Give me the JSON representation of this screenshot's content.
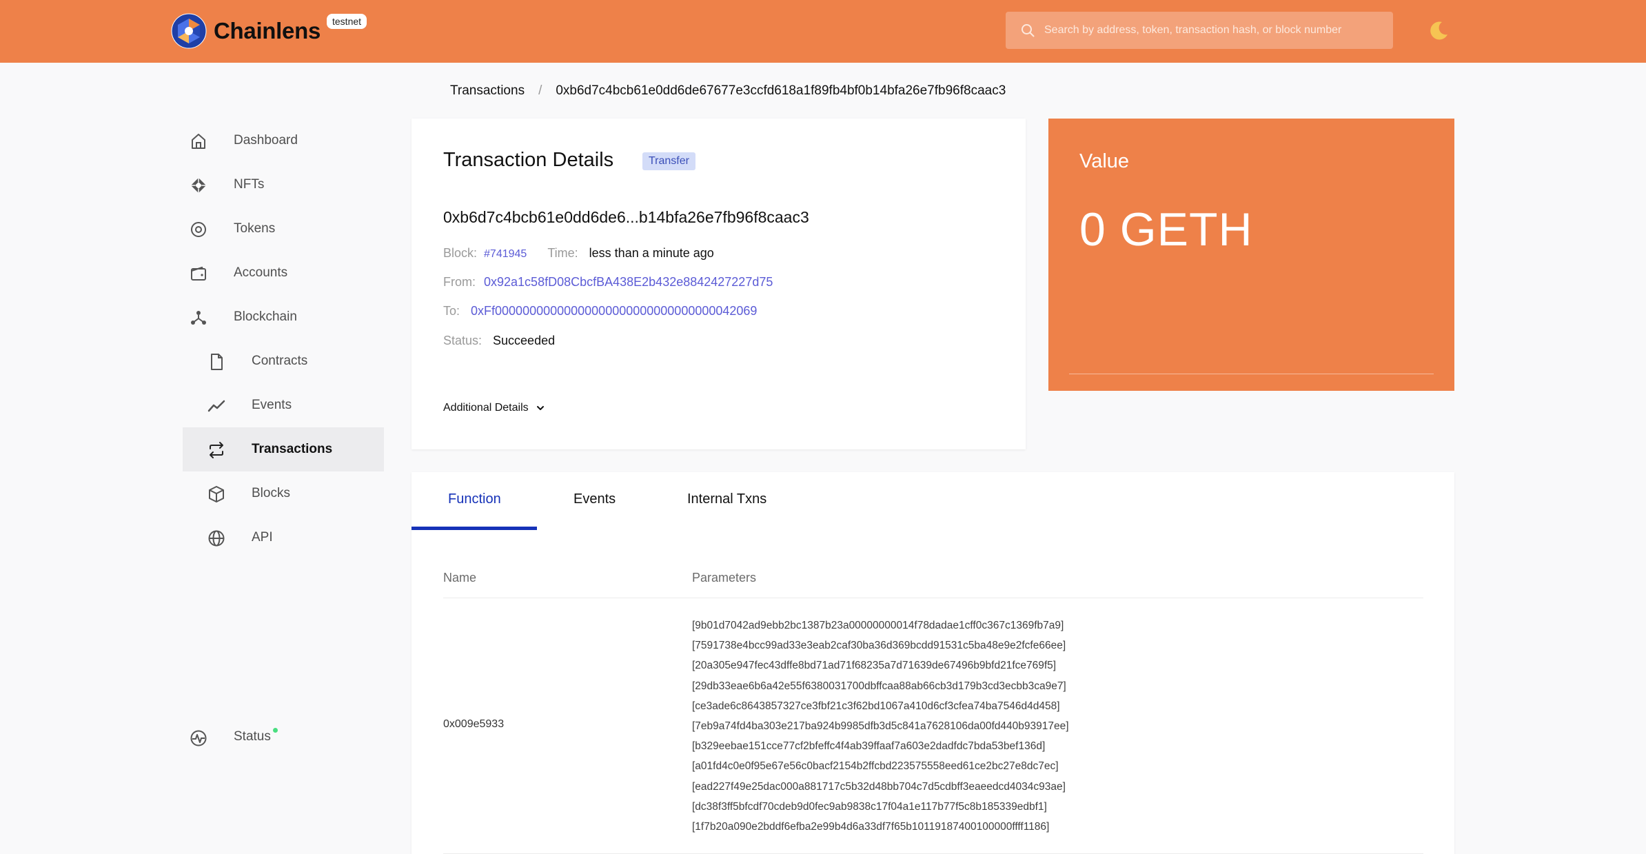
{
  "header": {
    "brand": "Chainlens",
    "env_badge": "testnet",
    "search_placeholder": "Search by address, token, transaction hash, or block number",
    "accent": "#ee8149"
  },
  "sidebar": {
    "items": [
      {
        "label": "Dashboard",
        "icon": "home-icon"
      },
      {
        "label": "NFTs",
        "icon": "diamond-icon"
      },
      {
        "label": "Tokens",
        "icon": "coin-icon"
      },
      {
        "label": "Accounts",
        "icon": "wallet-icon"
      },
      {
        "label": "Blockchain",
        "icon": "network-icon"
      },
      {
        "label": "Contracts",
        "icon": "document-icon"
      },
      {
        "label": "Events",
        "icon": "trend-icon"
      },
      {
        "label": "Transactions",
        "icon": "arrows-swap-icon",
        "active": true
      },
      {
        "label": "Blocks",
        "icon": "cube-icon"
      },
      {
        "label": "API",
        "icon": "globe-icon"
      }
    ],
    "status_label": "Status"
  },
  "breadcrumb": {
    "parent": "Transactions",
    "separator": "/",
    "current": "0xb6d7c4bcb61e0dd6de67677e3ccfd618a1f89fb4bf0b14bfa26e7fb96f8caac3"
  },
  "details": {
    "title": "Transaction Details",
    "type_badge": "Transfer",
    "hash_short": "0xb6d7c4bcb61e0dd6de6...b14bfa26e7fb96f8caac3",
    "block_label": "Block:",
    "block_value": "#741945",
    "time_label": "Time:",
    "time_value": "less than a minute ago",
    "from_label": "From:",
    "from_value": "0x92a1c58fD08CbcfBA438E2b432e8842427227d75",
    "to_label": "To:",
    "to_value": "0xFf00000000000000000000000000000000042069",
    "status_label": "Status:",
    "status_value": "Succeeded",
    "additional_label": "Additional Details"
  },
  "value_card": {
    "label": "Value",
    "amount": "0 GETH"
  },
  "tabs": {
    "items": [
      "Function",
      "Events",
      "Internal Txns"
    ],
    "active": "Function",
    "columns": [
      "Name",
      "Parameters"
    ],
    "function_name": "0x009e5933",
    "parameters": [
      "[9b01d7042ad9ebb2bc1387b23a00000000014f78dadae1cff0c367c1369fb7a9]",
      "[7591738e4bcc99ad33e3eab2caf30ba36d369bcdd91531c5ba48e9e2fcfe66ee]",
      "[20a305e947fec43dffe8bd71ad71f68235a7d71639de67496b9bfd21fce769f5]",
      "[29db33eae6b6a42e55f6380031700dbffcaa88ab66cb3d179b3cd3ecbb3ca9e7]",
      "[ce3ade6c8643857327ce3fbf21c3f62bd1067a410d6cf3cfea74ba7546d4d458]",
      "[7eb9a74fd4ba303e217ba924b9985dfb3d5c841a7628106da00fd440b93917ee]",
      "[b329eebae151cce77cf2bfeffc4f4ab39ffaaf7a603e2dadfdc7bda53bef136d]",
      "[a01fd4c0e0f95e67e56c0bacf2154b2ffcbd223575558eed61ce2bc27e8dc7ec]",
      "[ead227f49e25dac000a881717c5b32d48bb704c7d5cdbff3eaeedcd4034c93ae]",
      "[dc38f3ff5bfcdf70cdeb9d0fec9ab9838c17f04a1e117b77f5c8b185339edbf1]",
      "[1f7b20a090e2bddf6efba2e99b4d6a33df7f65b10119187400100000ffff1186]"
    ]
  }
}
